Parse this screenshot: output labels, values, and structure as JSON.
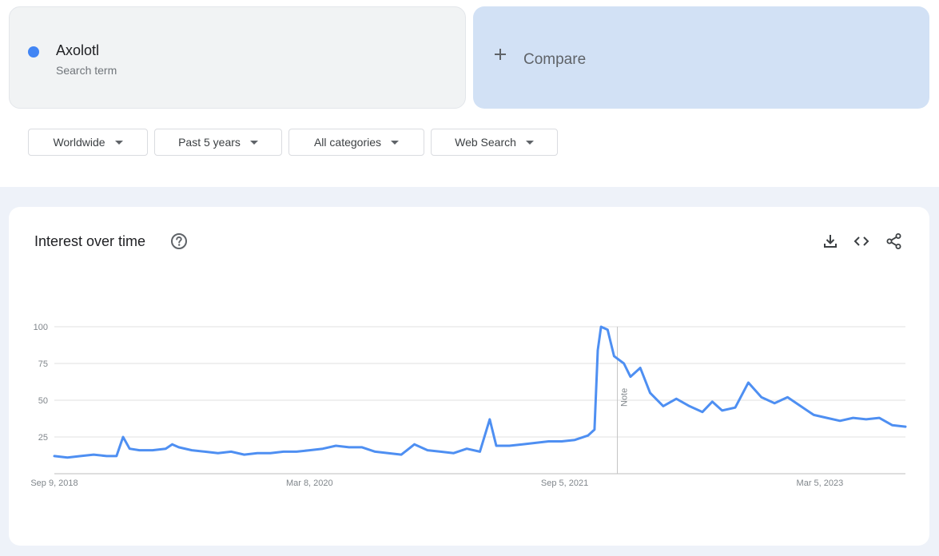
{
  "search_term": {
    "name": "Axolotl",
    "subtitle": "Search term",
    "dot_color": "#4285f4"
  },
  "compare": {
    "label": "Compare",
    "icon": "plus-icon"
  },
  "filters": [
    {
      "label": "Worldwide",
      "icon": "caret-down-icon"
    },
    {
      "label": "Past 5 years",
      "icon": "caret-down-icon"
    },
    {
      "label": "All categories",
      "icon": "caret-down-icon"
    },
    {
      "label": "Web Search",
      "icon": "caret-down-icon"
    }
  ],
  "chart_card": {
    "title": "Interest over time",
    "help_icon": "help-circle-icon",
    "toolbar_icons": [
      "download-icon",
      "embed-code-icon",
      "share-icon"
    ]
  },
  "chart_data": {
    "type": "line",
    "title": "Interest over time",
    "xlabel": "",
    "ylabel": "",
    "ylim": [
      0,
      100
    ],
    "y_ticks": [
      "25",
      "50",
      "75",
      "100"
    ],
    "x_tick_labels": [
      "Sep 9, 2018",
      "Mar 8, 2020",
      "Sep 5, 2021",
      "Mar 5, 2023"
    ],
    "x_start": "2018-09-09",
    "x_end": "2023-09-03",
    "grid": true,
    "annotation": {
      "label": "Note",
      "date": "2021-12-26"
    },
    "series": [
      {
        "name": "Axolotl",
        "color": "#4e8ff2",
        "points": [
          [
            "2018-09-09",
            12
          ],
          [
            "2018-10-07",
            11
          ],
          [
            "2018-11-04",
            12
          ],
          [
            "2018-12-02",
            13
          ],
          [
            "2018-12-30",
            12
          ],
          [
            "2019-01-20",
            12
          ],
          [
            "2019-02-03",
            25
          ],
          [
            "2019-02-17",
            17
          ],
          [
            "2019-03-10",
            16
          ],
          [
            "2019-04-07",
            16
          ],
          [
            "2019-05-05",
            17
          ],
          [
            "2019-05-19",
            20
          ],
          [
            "2019-06-02",
            18
          ],
          [
            "2019-06-30",
            16
          ],
          [
            "2019-07-28",
            15
          ],
          [
            "2019-08-25",
            14
          ],
          [
            "2019-09-22",
            15
          ],
          [
            "2019-10-20",
            13
          ],
          [
            "2019-11-17",
            14
          ],
          [
            "2019-12-15",
            14
          ],
          [
            "2020-01-12",
            15
          ],
          [
            "2020-02-09",
            15
          ],
          [
            "2020-03-08",
            16
          ],
          [
            "2020-04-05",
            17
          ],
          [
            "2020-05-03",
            19
          ],
          [
            "2020-05-31",
            18
          ],
          [
            "2020-06-28",
            18
          ],
          [
            "2020-07-26",
            15
          ],
          [
            "2020-08-23",
            14
          ],
          [
            "2020-09-20",
            13
          ],
          [
            "2020-10-18",
            20
          ],
          [
            "2020-11-15",
            16
          ],
          [
            "2020-12-13",
            15
          ],
          [
            "2021-01-10",
            14
          ],
          [
            "2021-02-07",
            17
          ],
          [
            "2021-03-07",
            15
          ],
          [
            "2021-03-28",
            37
          ],
          [
            "2021-04-11",
            19
          ],
          [
            "2021-05-09",
            19
          ],
          [
            "2021-06-06",
            20
          ],
          [
            "2021-07-04",
            21
          ],
          [
            "2021-08-01",
            22
          ],
          [
            "2021-08-29",
            22
          ],
          [
            "2021-09-26",
            23
          ],
          [
            "2021-10-24",
            26
          ],
          [
            "2021-11-07",
            30
          ],
          [
            "2021-11-14",
            84
          ],
          [
            "2021-11-21",
            100
          ],
          [
            "2021-12-05",
            98
          ],
          [
            "2021-12-19",
            80
          ],
          [
            "2022-01-09",
            75
          ],
          [
            "2022-01-23",
            66
          ],
          [
            "2022-02-13",
            72
          ],
          [
            "2022-03-06",
            55
          ],
          [
            "2022-04-03",
            46
          ],
          [
            "2022-05-01",
            51
          ],
          [
            "2022-05-29",
            46
          ],
          [
            "2022-06-26",
            42
          ],
          [
            "2022-07-17",
            49
          ],
          [
            "2022-08-07",
            43
          ],
          [
            "2022-09-04",
            45
          ],
          [
            "2022-10-02",
            62
          ],
          [
            "2022-10-30",
            52
          ],
          [
            "2022-11-27",
            48
          ],
          [
            "2022-12-25",
            52
          ],
          [
            "2023-01-22",
            46
          ],
          [
            "2023-02-19",
            40
          ],
          [
            "2023-03-19",
            38
          ],
          [
            "2023-04-16",
            36
          ],
          [
            "2023-05-14",
            38
          ],
          [
            "2023-06-11",
            37
          ],
          [
            "2023-07-09",
            38
          ],
          [
            "2023-08-06",
            33
          ],
          [
            "2023-09-03",
            32
          ]
        ]
      }
    ]
  }
}
